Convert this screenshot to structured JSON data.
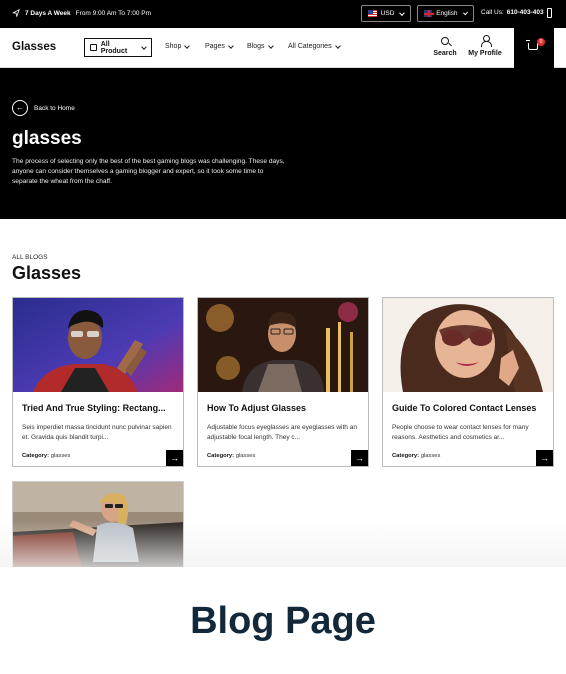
{
  "topbar": {
    "hours_bold": "7 Days A Week",
    "hours_rest": "From 9:00 Am To 7:00 Pm",
    "currency": "USD",
    "language": "English",
    "call_label": "Call Us:",
    "call_number": "610-403-403"
  },
  "header": {
    "logo": "Glasses",
    "all_product": "All Product",
    "nav": [
      "Shop",
      "Pages",
      "Blogs",
      "All Categories"
    ],
    "search_label": "Search",
    "profile_label": "My Profile",
    "cart_count": "0"
  },
  "hero": {
    "back_label": "Back to Home",
    "title": "glasses",
    "description": "The process of selecting only the best of the best gaming blogs was challenging. These days, anyone can consider themselves a gaming blogger and expert, so it took some time to separate the wheat from the chaff."
  },
  "blogs": {
    "kicker": "ALL BLOGS",
    "title": "Glasses",
    "category_label": "Category:",
    "posts": [
      {
        "title": "Tried And True Styling: Rectang...",
        "excerpt": "Seis imperdiet massa tincidunt nunc pulvinar sapien et. Gravida quis blandit turpi...",
        "category": "glasses"
      },
      {
        "title": "How To Adjust Glasses",
        "excerpt": "Adjustable focus eyeglasses are eyeglasses with an adjustable focal length. They c...",
        "category": "glasses"
      },
      {
        "title": "Guide To Colored Contact Lenses",
        "excerpt": "People choose to wear contact lenses for many reasons. Aesthetics and cosmetics ar...",
        "category": "glasses"
      }
    ]
  },
  "banner": {
    "title": "Blog Page"
  },
  "colors": {
    "dark": "#000000",
    "banner_text": "#13293a",
    "badge": "#e03030"
  }
}
